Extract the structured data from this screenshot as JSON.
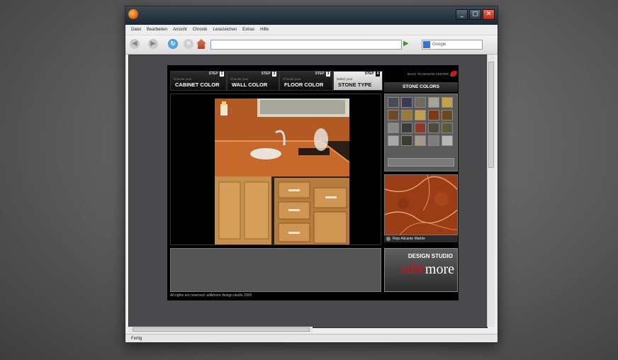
{
  "browser": {
    "menu": [
      "Datei",
      "Bearbeiten",
      "Ansicht",
      "Chronik",
      "Lesezeichen",
      "Extras",
      "Hilfe"
    ],
    "search_placeholder": "Google",
    "url": "",
    "status": "Fertig"
  },
  "app": {
    "tabs": [
      {
        "step": "STEP",
        "num": "1",
        "choose": "Choose your",
        "label": "CABINET COLOR",
        "active": false
      },
      {
        "step": "STEP",
        "num": "2",
        "choose": "Choose your",
        "label": "WALL COLOR",
        "active": false
      },
      {
        "step": "STEP",
        "num": "3",
        "choose": "Choose your",
        "label": "FLOOR COLOR",
        "active": false
      },
      {
        "step": "STEP",
        "num": "4",
        "choose": "Select your",
        "label": "STONE TYPE",
        "active": true
      }
    ],
    "back_link": "BACK TO DESIGN CENTER",
    "stone_header": "STONE COLORS",
    "swatch_colors": [
      "#4a4a55",
      "#3a3a52",
      "#6f6a5c",
      "#a8a39a",
      "#c2a34a",
      "#6b4a2a",
      "#9a7a3a",
      "#c0a050",
      "#7a3a1a",
      "#6a4a1c",
      "#8a8a8a",
      "#3b3b3b",
      "#8a3a2a",
      "#4a4a40",
      "#5a5a3a",
      "#aaaaaa",
      "#3c3a34",
      "#a49a8a",
      "#7d7d7d",
      "#b7b7b7"
    ],
    "selected_stone": "Rojo Alicante Marble",
    "logo": {
      "line1": "DESIGN STUDIO",
      "prefix": "ad",
      "amp": "&",
      "suffix": "more"
    },
    "footer": "All rights are reserved.  ad&more design studio 2009"
  }
}
